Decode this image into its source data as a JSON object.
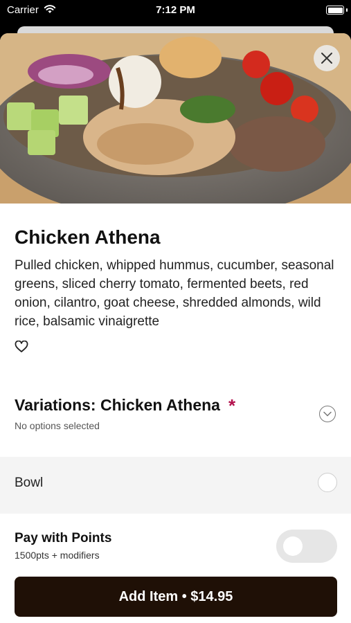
{
  "status_bar": {
    "carrier": "Carrier",
    "time": "7:12 PM"
  },
  "item": {
    "title": "Chicken Athena",
    "description": "Pulled chicken, whipped hummus, cucumber, seasonal greens, sliced cherry tomato, fermented beets, red onion, cilantro, goat cheese, shredded almonds, wild rice, balsamic vinaigrette"
  },
  "variations": {
    "title": "Variations: Chicken Athena",
    "required_marker": "*",
    "subtitle": "No options selected",
    "options": [
      {
        "label": "Bowl",
        "selected": false
      }
    ]
  },
  "points": {
    "title": "Pay with Points",
    "subtitle": "1500pts + modifiers",
    "enabled": false
  },
  "add_button": {
    "label": "Add Item • $14.95"
  },
  "colors": {
    "button_bg": "#1f1006",
    "required": "#b3124d",
    "toggle_off": "#e6e6e6"
  }
}
